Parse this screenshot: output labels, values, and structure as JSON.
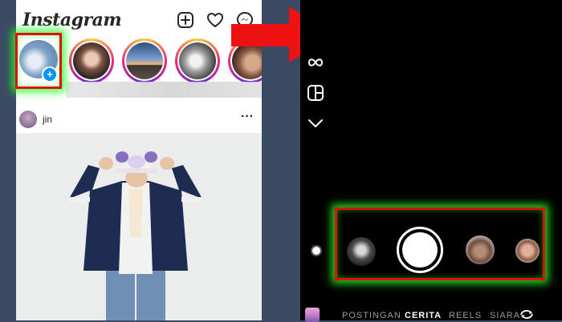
{
  "left_panel": {
    "app_title": "Instagram",
    "header_icons": [
      "new-post-icon",
      "heart-icon",
      "messenger-icon"
    ],
    "stories": [
      {
        "name": "your-story",
        "has_add_badge": true,
        "add_badge_symbol": "+"
      },
      {
        "name": "story-1"
      },
      {
        "name": "story-2"
      },
      {
        "name": "story-3"
      },
      {
        "name": "story-4"
      }
    ],
    "post": {
      "username": "jin",
      "more_symbol": "···"
    }
  },
  "camera_panel": {
    "side_icons": [
      "boomerang-icon",
      "layout-icon",
      "chevron-down-icon"
    ],
    "modes": [
      "POSTINGAN",
      "CERITA",
      "REELS",
      "SIARA"
    ],
    "active_mode": "CERITA"
  },
  "colors": {
    "highlight_border": "#e01010",
    "highlight_glow": "#28ff28",
    "arrow": "#ee1111",
    "add_badge": "#0095f6",
    "camera_background": "#000000"
  }
}
